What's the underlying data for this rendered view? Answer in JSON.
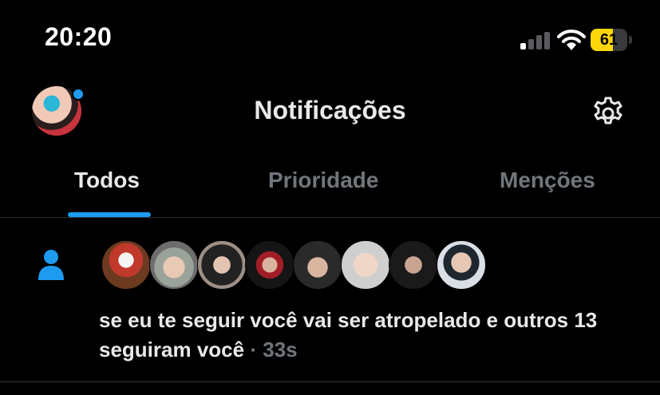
{
  "status_bar": {
    "time": "20:20",
    "battery_level": "61",
    "battery_fraction": 0.61,
    "battery_color": "#ffd60a"
  },
  "header": {
    "title": "Notificações",
    "avatar_icon": "profile-avatar",
    "settings_icon": "gear-icon"
  },
  "tabs": [
    {
      "label": "Todos",
      "active": true
    },
    {
      "label": "Prioridade",
      "active": false
    },
    {
      "label": "Menções",
      "active": false
    }
  ],
  "accent_color": "#1d9bf0",
  "notification": {
    "icon": "person-icon",
    "avatar_count": 8,
    "text_main": "se eu te seguir você vai ser atropelado e outros 13 seguiram você",
    "separator": "·",
    "time_ago": "33s"
  }
}
